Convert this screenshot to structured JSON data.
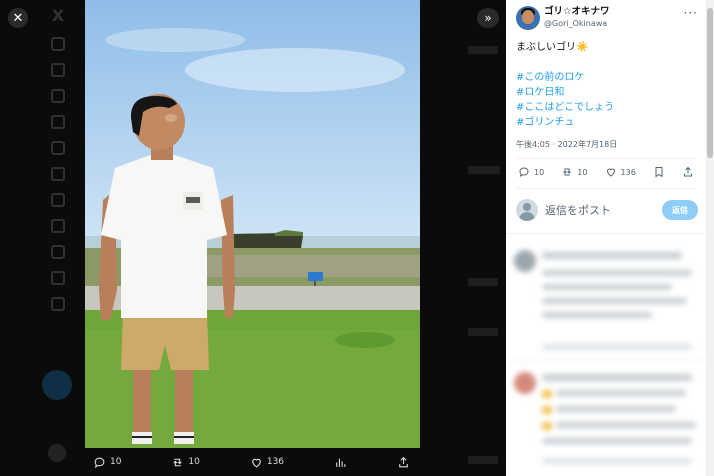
{
  "viewer": {
    "close_icon": "close-icon",
    "expand_icon": "expand-icon",
    "photo_actions": {
      "replies": "10",
      "reposts": "10",
      "likes": "136"
    }
  },
  "tweet": {
    "display_name": "ゴリ☆オキナワ",
    "handle": "@Gori_Okinawa",
    "text": "まぶしいゴリ",
    "emoji": "☀️",
    "hashtags": [
      "#この前のロケ",
      "#ロケ日和",
      "#ここはどこでしょう",
      "#ゴリンチュ"
    ],
    "timestamp": "午後4:05 · 2022年7月18日",
    "actions": {
      "replies": "10",
      "reposts": "10",
      "likes": "136"
    }
  },
  "reply": {
    "placeholder": "返信をポスト",
    "button_label": "返信"
  },
  "colors": {
    "accent": "#1d9bf0",
    "reply_button": "#8ecdf8",
    "backdrop": "#0b0b0b"
  }
}
